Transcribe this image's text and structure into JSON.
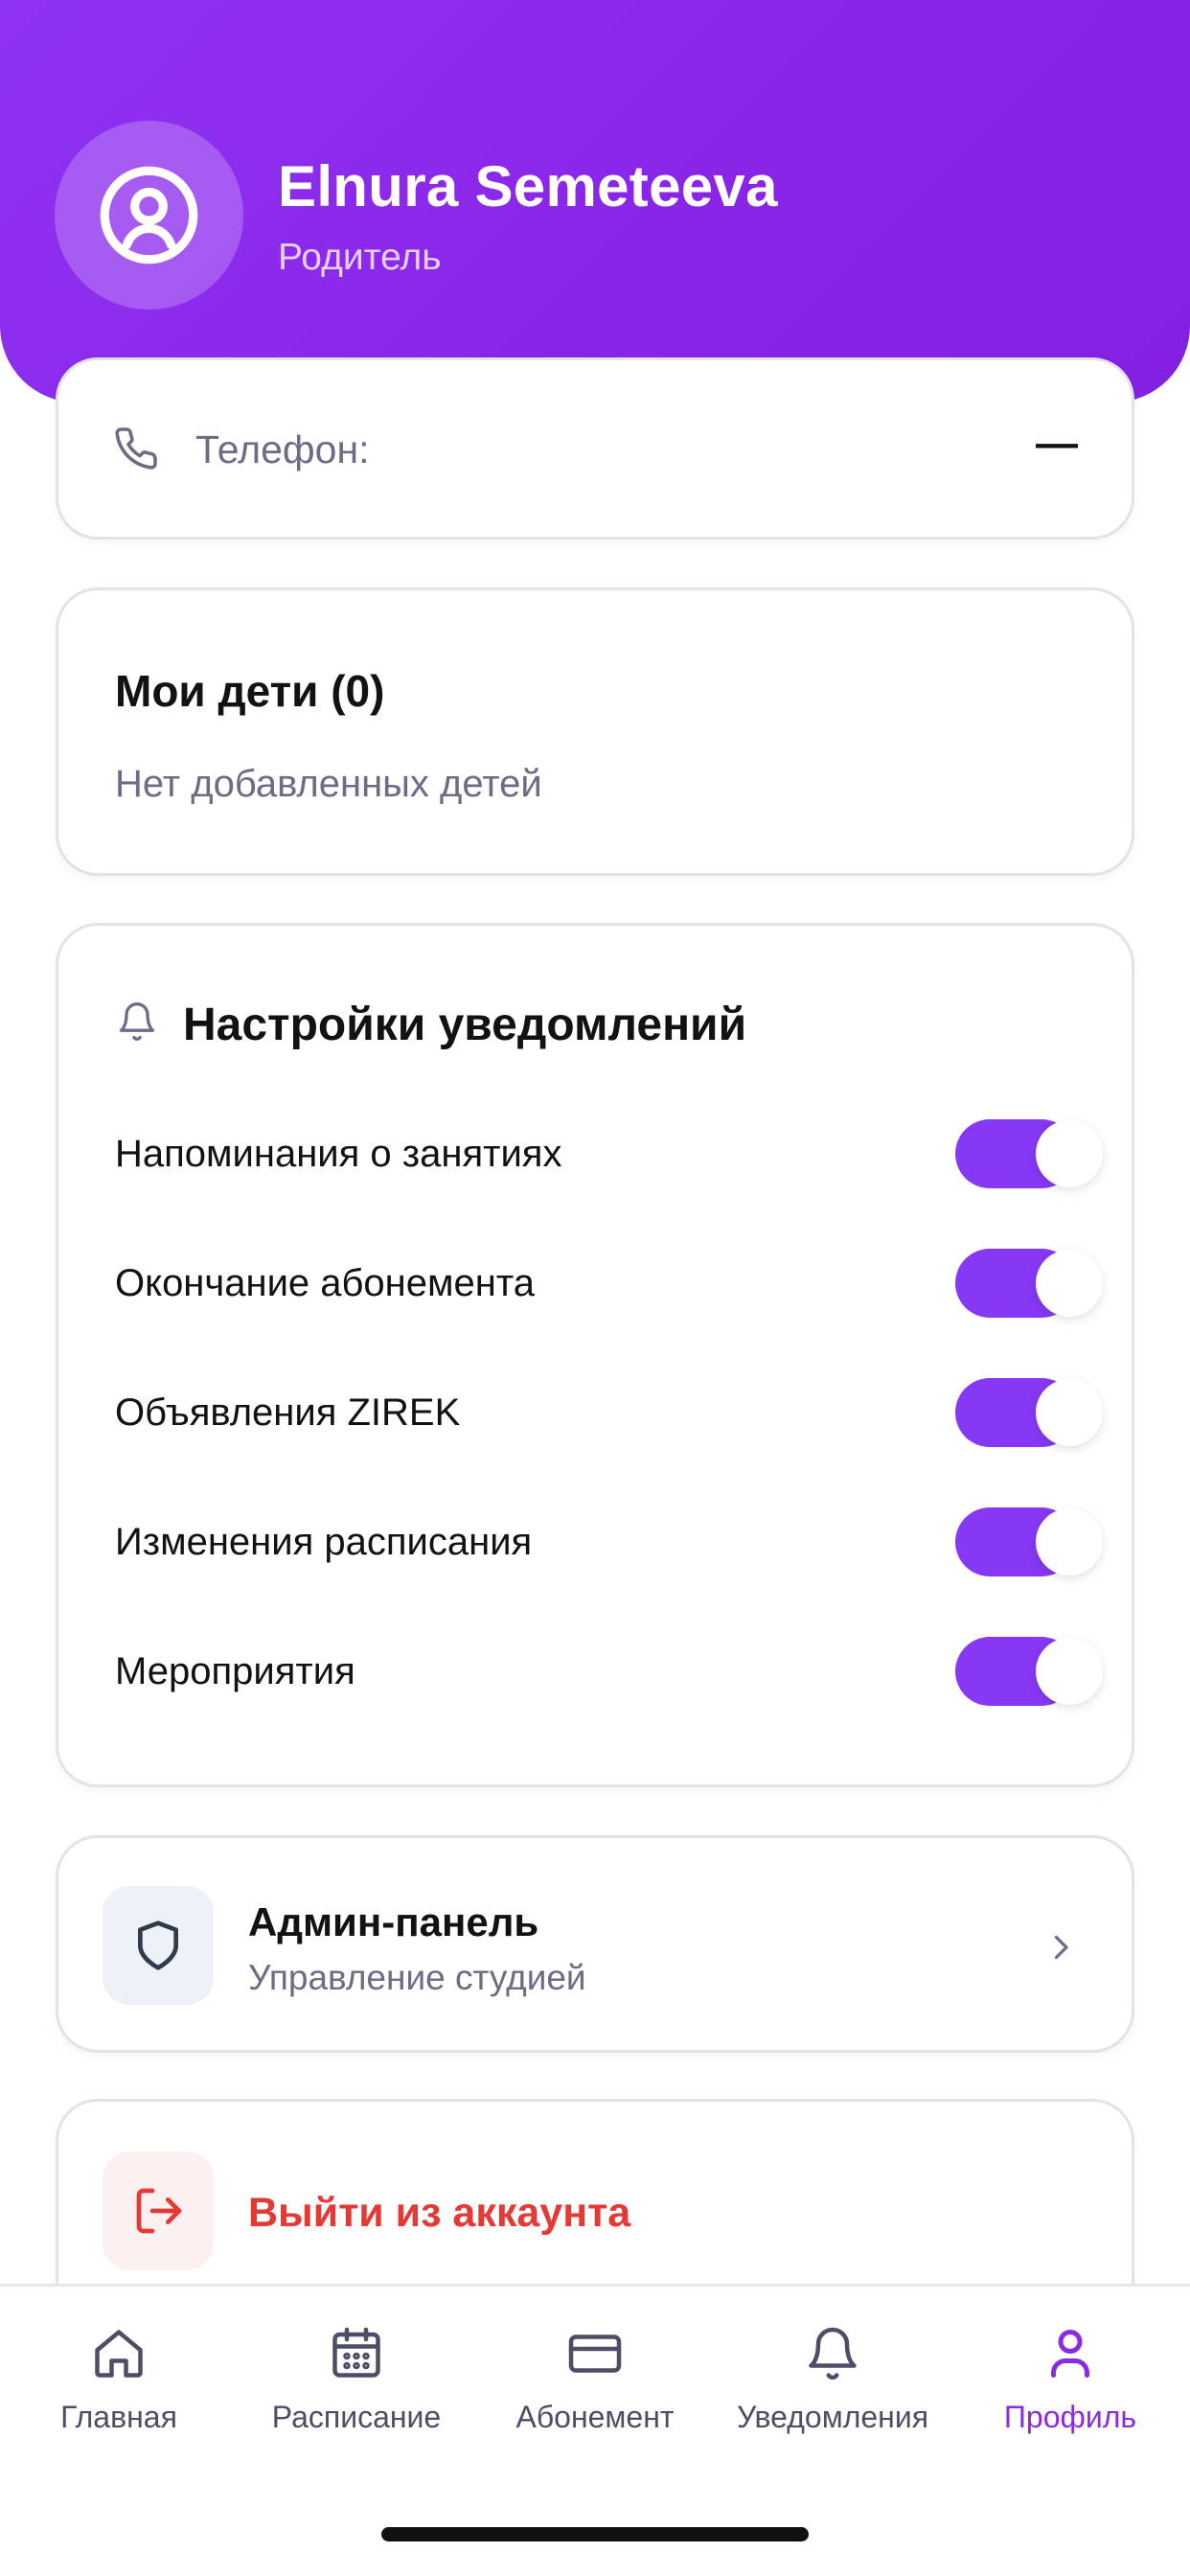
{
  "profile": {
    "name": "Elnura Semeteeva",
    "role": "Родитель"
  },
  "phone": {
    "label": "Телефон:",
    "value": "—"
  },
  "kids": {
    "title": "Мои дети (0)",
    "empty_text": "Нет добавленных детей"
  },
  "notifications": {
    "title": "Настройки уведомлений",
    "items": [
      {
        "label": "Напоминания о занятиях",
        "enabled": true
      },
      {
        "label": "Окончание абонемента",
        "enabled": true
      },
      {
        "label": "Объявления ZIREK",
        "enabled": true
      },
      {
        "label": "Изменения расписания",
        "enabled": true
      },
      {
        "label": "Мероприятия",
        "enabled": true
      }
    ]
  },
  "admin": {
    "title": "Админ-панель",
    "subtitle": "Управление студией"
  },
  "logout": {
    "label": "Выйти из аккаунта"
  },
  "nav": {
    "items": [
      {
        "label": "Главная",
        "icon": "home-icon",
        "active": false
      },
      {
        "label": "Расписание",
        "icon": "calendar-icon",
        "active": false
      },
      {
        "label": "Абонемент",
        "icon": "card-icon",
        "active": false
      },
      {
        "label": "Уведомления",
        "icon": "bell-icon",
        "active": false
      },
      {
        "label": "Профиль",
        "icon": "user-icon",
        "active": true
      }
    ]
  },
  "colors": {
    "accent": "#8638f4",
    "header": "#8a25e8",
    "danger": "#e53935",
    "active_nav": "#8a2be2"
  }
}
